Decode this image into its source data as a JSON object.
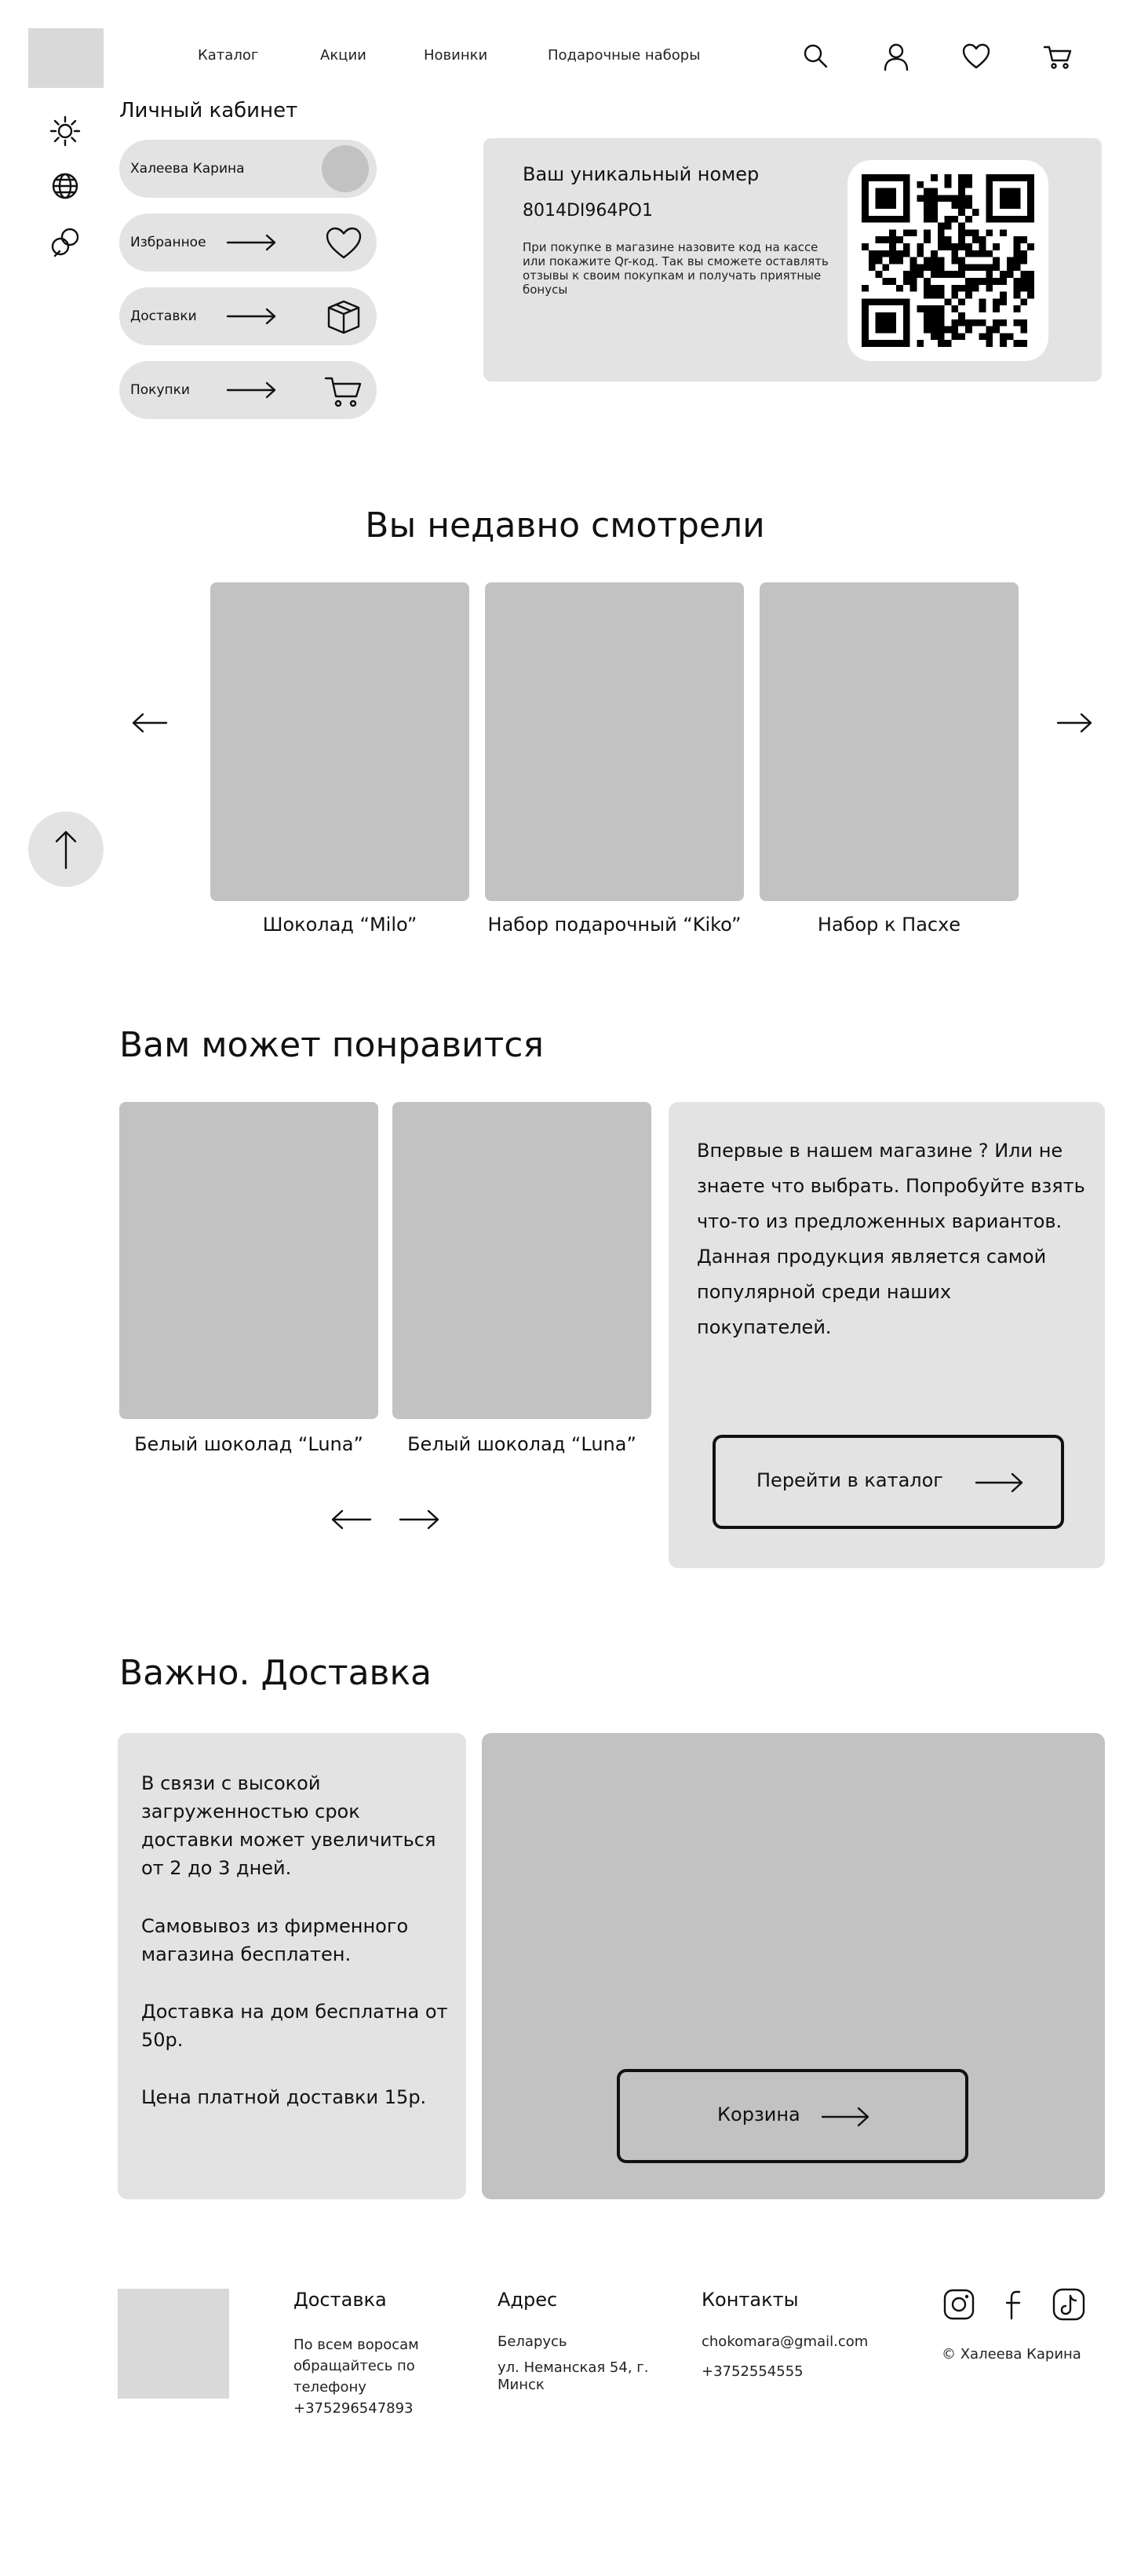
{
  "header": {
    "nav": [
      "Каталог",
      "Акции",
      "Новинки",
      "Подарочные наборы"
    ],
    "icons": [
      "search-icon",
      "user-icon",
      "heart-icon",
      "cart-icon"
    ]
  },
  "side_icons": [
    "sun-icon",
    "globe-icon",
    "palette-icon"
  ],
  "profile": {
    "title": "Личный кабинет",
    "user_name": "Халеева Карина",
    "items": [
      {
        "label": "Избранное",
        "icon": "heart-icon"
      },
      {
        "label": "Доставки",
        "icon": "box-icon"
      },
      {
        "label": "Покупки",
        "icon": "cart-icon"
      }
    ]
  },
  "loyalty": {
    "title": "Ваш уникальный номер",
    "code": "8014DI964PO1",
    "hint": "При покупке в магазине назовите код на кассе или покажите Qr-код. Так вы сможете оставлять отзывы к своим покупкам и получать приятные бонусы"
  },
  "recent": {
    "title": "Вы недавно смотрели",
    "products": [
      "Шоколад “Milo”",
      "Набор подарочный “Kiko”",
      "Набор к Пасхе"
    ]
  },
  "like": {
    "title": "Вам может понравится",
    "products": [
      "Белый шоколад “Luna”",
      "Белый шоколад “Luna”"
    ],
    "info": "Впервые в нашем магазине ? Или не знаете что выбрать. Попробуйте взять что-то из предложенных вариантов. Данная продукция является самой популярной среди наших покупателей.",
    "catalog_button": "Перейти в каталог"
  },
  "delivery": {
    "title": "Важно. Доставка",
    "paragraphs": [
      "В связи с высокой загруженностью срок доставки может увеличиться от 2 до 3 дней.",
      "Самовывоз из фирменного магазина бесплатен.",
      "Доставка на дом бесплатна от 50р.",
      "Цена платной доставки 15р."
    ],
    "cart_button": "Корзина"
  },
  "footer": {
    "delivery_head": "Доставка",
    "delivery_text": "По всем воросам обращайтесь по телефону +375296547893",
    "address_head": "Адрес",
    "address_country": "Беларусь",
    "address_street": "ул. Неманская 54, г. Минск",
    "contacts_head": "Контакты",
    "email": "chokomara@gmail.com",
    "phone": "+3752554555",
    "copyright": "© Халеева Карина",
    "social_icons": [
      "instagram-icon",
      "facebook-icon",
      "tiktok-icon"
    ]
  }
}
